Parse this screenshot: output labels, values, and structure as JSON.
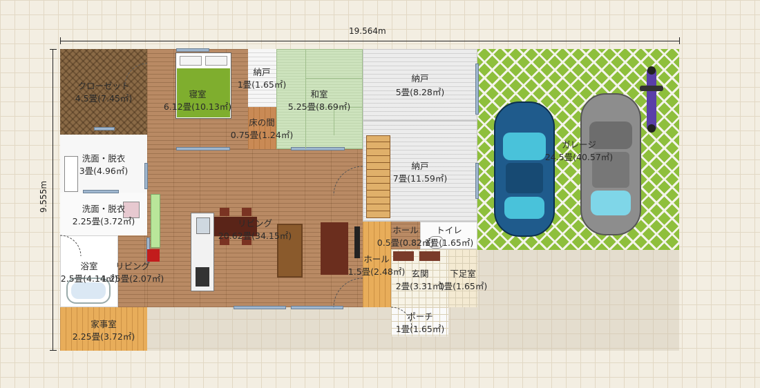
{
  "dimensions": {
    "width_label": "19.564m",
    "height_label": "9.555m"
  },
  "rooms": {
    "closet": {
      "name": "クローゼット",
      "area": "4.5畳(7.45㎡)"
    },
    "bedroom": {
      "name": "寝室",
      "area": "6.12畳(10.13㎡)"
    },
    "storage_a": {
      "name": "納戸",
      "area": "1畳(1.65㎡)"
    },
    "tokonoma": {
      "name": "床の間",
      "area": "0.75畳(1.24㎡)"
    },
    "washitsu": {
      "name": "和室",
      "area": "5.25畳(8.69㎡)"
    },
    "storage_b": {
      "name": "納戸",
      "area": "5畳(8.28㎡)"
    },
    "storage_c": {
      "name": "納戸",
      "area": "7畳(11.59㎡)"
    },
    "garage": {
      "name": "ガレージ",
      "area": "24.5畳(40.57㎡)"
    },
    "washroom_a": {
      "name": "洗面・脱衣",
      "area": "3畳(4.96㎡)"
    },
    "washroom_b": {
      "name": "洗面・脱衣",
      "area": "2.25畳(3.72㎡)"
    },
    "living": {
      "name": "リビング",
      "area": "20.62畳(34.15㎡)"
    },
    "bath": {
      "name": "浴室",
      "area": "2.5畳(4.14㎡)"
    },
    "living_small": {
      "name": "リビング",
      "area": "1.25畳(2.07㎡)"
    },
    "hall_a": {
      "name": "ホール",
      "area": "0.5畳(0.82㎡)"
    },
    "toilet": {
      "name": "トイレ",
      "area": "1畳(1.65㎡)"
    },
    "hall_b": {
      "name": "ホール",
      "area": "1.5畳(2.48㎡)"
    },
    "entrance": {
      "name": "玄関",
      "area": "2畳(3.31㎡)"
    },
    "shoe_room": {
      "name": "下足室",
      "area": "1畳(1.65㎡)"
    },
    "porch": {
      "name": "ポーチ",
      "area": "1畳(1.65㎡)"
    },
    "utility": {
      "name": "家事室",
      "area": "2.25畳(3.72㎡)"
    }
  },
  "colors": {
    "wood_floor": "#b98a64",
    "tatami": "#cde3bd",
    "garage_floor": "#8ebf3c",
    "car_blue": "#1f5b8c",
    "car_silver": "#8d8d8d",
    "motorcycle": "#5a3fa8"
  }
}
